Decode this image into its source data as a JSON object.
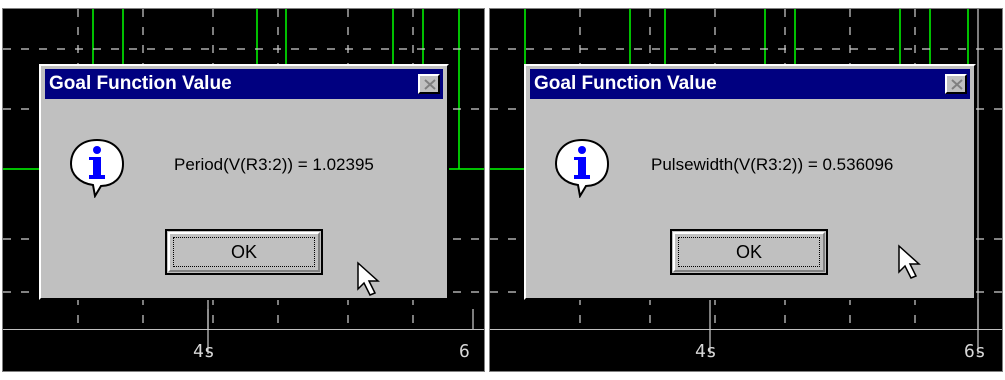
{
  "panels": [
    {
      "axis_labels": [
        "4s",
        "6"
      ],
      "dialog": {
        "title": "Goal Function Value",
        "message": "Period(V(R3:2)) = 1.02395",
        "ok_label": "OK",
        "icon": "info-icon"
      }
    },
    {
      "axis_labels": [
        "4s",
        "6s"
      ],
      "dialog": {
        "title": "Goal Function Value",
        "message": "Pulsewidth(V(R3:2)) = 0.536096",
        "ok_label": "OK",
        "icon": "info-icon"
      }
    }
  ],
  "colors": {
    "trace": "#00ff00",
    "plot_bg": "#000000",
    "title_bar": "#000080",
    "dialog_bg": "#c0c0c0"
  }
}
